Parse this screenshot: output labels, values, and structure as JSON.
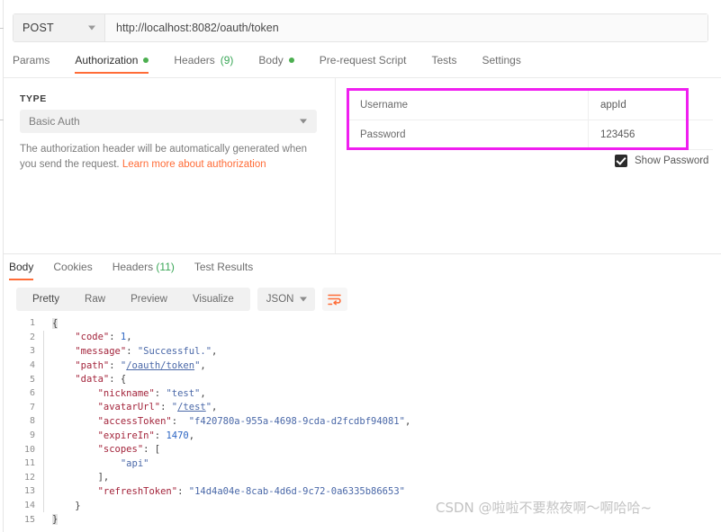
{
  "request": {
    "method": "POST",
    "url": "http://localhost:8082/oauth/token",
    "tabs": [
      {
        "label": "Params",
        "active": false,
        "dot": false,
        "count": ""
      },
      {
        "label": "Authorization",
        "active": true,
        "dot": true,
        "count": ""
      },
      {
        "label": "Headers",
        "active": false,
        "dot": false,
        "count": "(9)"
      },
      {
        "label": "Body",
        "active": false,
        "dot": true,
        "count": ""
      },
      {
        "label": "Pre-request Script",
        "active": false,
        "dot": false,
        "count": ""
      },
      {
        "label": "Tests",
        "active": false,
        "dot": false,
        "count": ""
      },
      {
        "label": "Settings",
        "active": false,
        "dot": false,
        "count": ""
      }
    ]
  },
  "auth": {
    "type_label": "TYPE",
    "type_value": "Basic Auth",
    "help_text": "The authorization header will be automatically generated when you send the request. ",
    "help_link": "Learn more about authorization",
    "fields": [
      {
        "key": "Username",
        "value": "appId"
      },
      {
        "key": "Password",
        "value": "123456"
      }
    ],
    "show_password_label": "Show Password",
    "show_password_checked": true,
    "highlight_color": "#f01ff0"
  },
  "response": {
    "tabs": [
      {
        "label": "Body",
        "active": true,
        "count": ""
      },
      {
        "label": "Cookies",
        "active": false,
        "count": ""
      },
      {
        "label": "Headers",
        "active": false,
        "count": "(11)"
      },
      {
        "label": "Test Results",
        "active": false,
        "count": ""
      }
    ],
    "formats": [
      {
        "label": "Pretty",
        "active": true
      },
      {
        "label": "Raw",
        "active": false
      },
      {
        "label": "Preview",
        "active": false
      },
      {
        "label": "Visualize",
        "active": false
      }
    ],
    "language": "JSON",
    "wrap_icon": "word-wrap-icon",
    "body_lines": [
      {
        "n": 1,
        "indent": 0,
        "fold": false,
        "segments": [
          {
            "t": "brace",
            "v": "{"
          }
        ]
      },
      {
        "n": 2,
        "indent": 1,
        "fold": true,
        "segments": [
          {
            "t": "key",
            "v": "\"code\""
          },
          {
            "t": "punct",
            "v": ": "
          },
          {
            "t": "num",
            "v": "1"
          },
          {
            "t": "punct",
            "v": ","
          }
        ]
      },
      {
        "n": 3,
        "indent": 1,
        "fold": true,
        "segments": [
          {
            "t": "key",
            "v": "\"message\""
          },
          {
            "t": "punct",
            "v": ": "
          },
          {
            "t": "str",
            "v": "\"Successful.\""
          },
          {
            "t": "punct",
            "v": ","
          }
        ]
      },
      {
        "n": 4,
        "indent": 1,
        "fold": true,
        "segments": [
          {
            "t": "key",
            "v": "\"path\""
          },
          {
            "t": "punct",
            "v": ": "
          },
          {
            "t": "str",
            "v": "\""
          },
          {
            "t": "url",
            "v": "/oauth/token"
          },
          {
            "t": "str",
            "v": "\""
          },
          {
            "t": "punct",
            "v": ","
          }
        ]
      },
      {
        "n": 5,
        "indent": 1,
        "fold": true,
        "segments": [
          {
            "t": "key",
            "v": "\"data\""
          },
          {
            "t": "punct",
            "v": ": {"
          }
        ]
      },
      {
        "n": 6,
        "indent": 2,
        "fold": true,
        "segments": [
          {
            "t": "key",
            "v": "\"nickname\""
          },
          {
            "t": "punct",
            "v": ": "
          },
          {
            "t": "str",
            "v": "\"test\""
          },
          {
            "t": "punct",
            "v": ","
          }
        ]
      },
      {
        "n": 7,
        "indent": 2,
        "fold": true,
        "segments": [
          {
            "t": "key",
            "v": "\"avatarUrl\""
          },
          {
            "t": "punct",
            "v": ": "
          },
          {
            "t": "str",
            "v": "\""
          },
          {
            "t": "url",
            "v": "/test"
          },
          {
            "t": "str",
            "v": "\""
          },
          {
            "t": "punct",
            "v": ","
          }
        ]
      },
      {
        "n": 8,
        "indent": 2,
        "fold": true,
        "segments": [
          {
            "t": "key",
            "v": "\"accessToken\""
          },
          {
            "t": "punct",
            "v": ":  "
          },
          {
            "t": "str",
            "v": "\"f420780a-955a-4698-9cda-d2fcdbf94081\""
          },
          {
            "t": "punct",
            "v": ","
          }
        ]
      },
      {
        "n": 9,
        "indent": 2,
        "fold": true,
        "segments": [
          {
            "t": "key",
            "v": "\"expireIn\""
          },
          {
            "t": "punct",
            "v": ": "
          },
          {
            "t": "num",
            "v": "1470"
          },
          {
            "t": "punct",
            "v": ","
          }
        ]
      },
      {
        "n": 10,
        "indent": 2,
        "fold": true,
        "segments": [
          {
            "t": "key",
            "v": "\"scopes\""
          },
          {
            "t": "punct",
            "v": ": ["
          }
        ]
      },
      {
        "n": 11,
        "indent": 3,
        "fold": true,
        "segments": [
          {
            "t": "str",
            "v": "\"api\""
          }
        ]
      },
      {
        "n": 12,
        "indent": 2,
        "fold": true,
        "segments": [
          {
            "t": "punct",
            "v": "],"
          }
        ]
      },
      {
        "n": 13,
        "indent": 2,
        "fold": true,
        "segments": [
          {
            "t": "key",
            "v": "\"refreshToken\""
          },
          {
            "t": "punct",
            "v": ": "
          },
          {
            "t": "str",
            "v": "\"14d4a04e-8cab-4d6d-9c72-0a6335b86653\""
          }
        ]
      },
      {
        "n": 14,
        "indent": 1,
        "fold": true,
        "segments": [
          {
            "t": "punct",
            "v": "}"
          }
        ]
      },
      {
        "n": 15,
        "indent": 0,
        "fold": false,
        "segments": [
          {
            "t": "brace",
            "v": "}"
          }
        ]
      }
    ]
  },
  "watermark": "CSDN @啦啦不要熬夜啊～啊哈哈~"
}
